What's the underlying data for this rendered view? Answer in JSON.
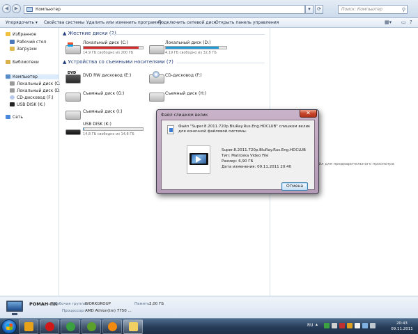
{
  "address": {
    "path": "Компьютер",
    "search_placeholder": "Поиск: Компьютер"
  },
  "toolbar": {
    "organize": "Упорядочить ▾",
    "system_properties": "Свойства системы",
    "uninstall": "Удалить или изменить программу",
    "map_drive": "Подключить сетевой диск",
    "control_panel": "Открыть панель управления"
  },
  "nav": {
    "favorites": "Избранное",
    "desktop": "Рабочий стол",
    "downloads": "Загрузки",
    "libraries": "Библиотеки",
    "computer": "Компьютер",
    "drive_c": "Локальный диск (C:)",
    "drive_d": "Локальный диск (D:)",
    "drive_f": "CD-дисковод (F:)",
    "drive_k": "USB DISK (K:)",
    "network": "Сеть"
  },
  "hard_drives": {
    "header": "Жесткие диски (2)",
    "items": [
      {
        "name": "Локальный диск (C:)",
        "free": "14,9 ГБ свободно из 200 ГБ",
        "used_fraction": 0.93,
        "color": "#d42a2a"
      },
      {
        "name": "Локальный диск (D:)",
        "free": "4,19 ГБ свободно из 32,8 ГБ",
        "used_fraction": 0.87,
        "color": "#1e9ad6"
      }
    ]
  },
  "removable": {
    "header": "Устройства со съемными носителями (7)",
    "items": [
      {
        "name": "DVD RW дисковод (E:)"
      },
      {
        "name": "CD-дисковод (F:)"
      },
      {
        "name": "Съемный диск (G:)"
      },
      {
        "name": "Съемный диск (H:)"
      },
      {
        "name": "Съемный диск (I:)"
      },
      {
        "name": "USB DISK (K:)",
        "free": "14,8 ГБ свободно из 14,8 ГБ",
        "used_fraction": 0.01
      }
    ]
  },
  "preview": {
    "text": "айл для предварительного просмотра"
  },
  "details": {
    "name": "РОМАН-ПК",
    "workgroup_label": "Рабочая группа:",
    "workgroup": "WORKGROUP",
    "memory_label": "Память:",
    "memory": "2,00 ГБ",
    "cpu_label": "Процессор:",
    "cpu": "AMD Athlon(tm) 7750 ..."
  },
  "dialog": {
    "title": "Файл слишком велик",
    "close": "✕",
    "message": "Файл \"Super.8.2011.720p.BluRay.Rus.Eng.HDCLUB\" слишком велик для конечной файловой системы.",
    "file_name": "Super.8.2011.720p.BluRay.Rus.Eng.HDCLUB",
    "file_type": "Тип: Matroska Video File",
    "file_size": "Размер: 6,90 ГБ",
    "file_modified": "Дата изменения: 09.11.2011 20:40",
    "cancel": "Отмена"
  },
  "taskbar": {
    "lang": "RU",
    "time": "20:43",
    "date": "09.11.2011",
    "apps": [
      {
        "icon": "media-player-icon",
        "color": "#e8a21a"
      },
      {
        "icon": "opera-icon",
        "color": "#d01818"
      },
      {
        "icon": "chrome-icon",
        "color": "#3aa040"
      },
      {
        "icon": "utorrent-icon",
        "color": "#5aa02a"
      },
      {
        "icon": "vlc-icon",
        "color": "#f08a10"
      },
      {
        "icon": "explorer-icon",
        "color": "#f2cf63"
      }
    ]
  }
}
